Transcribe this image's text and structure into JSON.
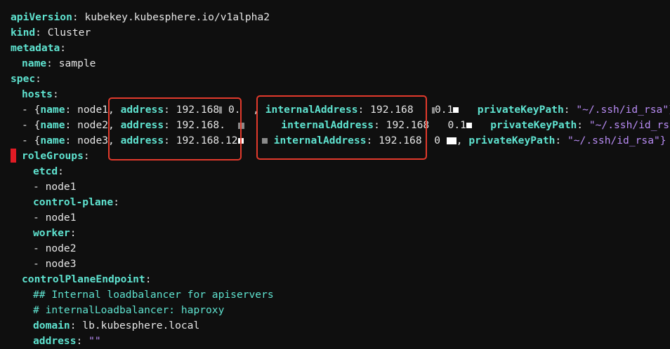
{
  "yaml": {
    "l1": {
      "key": "apiVersion",
      "sep": ": ",
      "val": "kubekey.kubesphere.io/v1alpha2"
    },
    "l2": {
      "key": "kind",
      "sep": ": ",
      "val": "Cluster"
    },
    "l3": {
      "key": "metadata",
      "sep": ":"
    },
    "l4": {
      "key": "name",
      "sep": ": ",
      "val": "sample"
    },
    "l5": {
      "key": "spec",
      "sep": ":"
    },
    "l6": {
      "key": "hosts",
      "sep": ":"
    },
    "hosts": [
      {
        "prefix": "- {",
        "name_key": "name",
        "name_val": "node1,",
        "addr_key": "address",
        "addr_val": "192.168",
        "addr_tail": "0.",
        "comma": "  ,",
        "int_key": "internalAddress",
        "int_val": "192.168",
        "int_tail": "0.1",
        "pk_key": "privateKeyPath",
        "pk_val": "\"~/.ssh/id_rsa\"}"
      },
      {
        "prefix": "- {",
        "name_key": "name",
        "name_val": "node2,",
        "addr_key": "address",
        "addr_val": "192.168.",
        "addr_tail": "",
        "comma": "",
        "int_key": "internalAddress",
        "int_val": "192.168",
        "int_tail": "0.1",
        "pk_key": "privateKeyPath",
        "pk_val": "\"~/.ssh/id_rsa\"}"
      },
      {
        "prefix": "- {",
        "name_key": "name",
        "name_val": "node3,",
        "addr_key": "address",
        "addr_val": "192.168.12",
        "addr_tail": "",
        "comma": "",
        "int_key": "internalAddress",
        "int_val": "192.168",
        "int_tail": "0",
        "pk_key": "privateKeyPath",
        "pk_val": "\"~/.ssh/id_rsa\"}"
      }
    ],
    "l10": {
      "key": "roleGroups",
      "sep": ":"
    },
    "l11": {
      "key": "etcd",
      "sep": ":"
    },
    "l12": {
      "dash": "- ",
      "val": "node1"
    },
    "l13": {
      "key": "control-plane",
      "sep": ":"
    },
    "l14": {
      "dash": "- ",
      "val": "node1"
    },
    "l15": {
      "key": "worker",
      "sep": ":"
    },
    "l16": {
      "dash": "- ",
      "val": "node2"
    },
    "l17": {
      "dash": "- ",
      "val": "node3"
    },
    "l18": {
      "key": "controlPlaneEndpoint",
      "sep": ":"
    },
    "l19": {
      "comment": "## Internal loadbalancer for apiservers"
    },
    "l20": {
      "comment": "# internalLoadbalancer: haproxy"
    },
    "l21": {
      "key": "domain",
      "sep": ": ",
      "val": "lb.kubesphere.local"
    },
    "l22": {
      "key": "address",
      "sep": ": ",
      "val": "\"\""
    },
    "pk_comma": ","
  },
  "colors": {
    "key": "#5fe3d0",
    "string": "#b98cf5",
    "text": "#e6e6e6",
    "background": "#0f0f0f",
    "highlight_box": "#e23a2c",
    "marker": "#e01b24"
  }
}
